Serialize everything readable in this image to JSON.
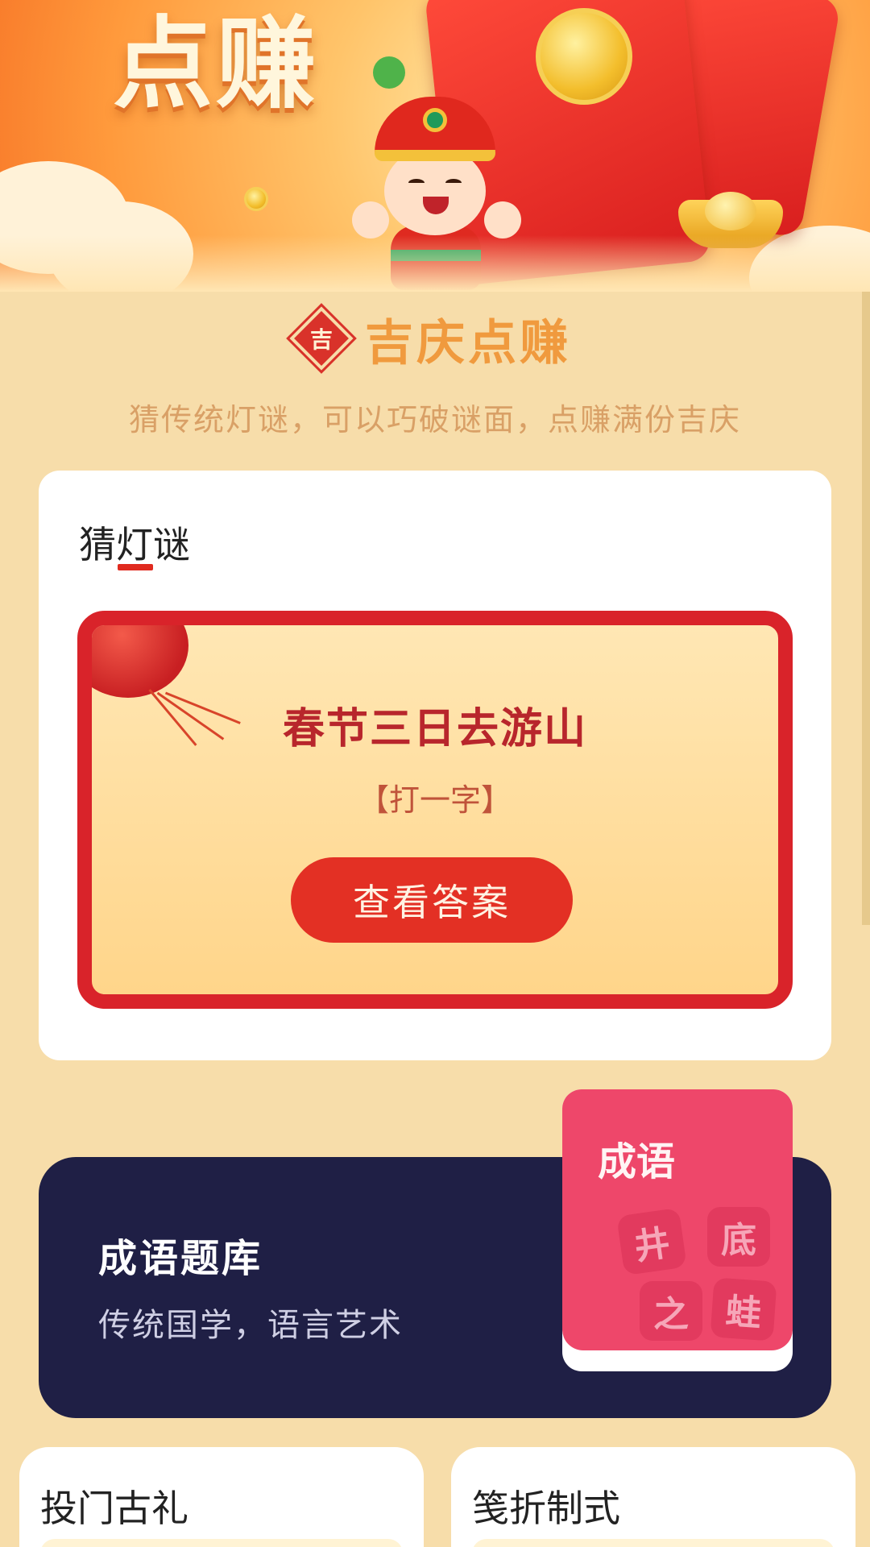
{
  "banner": {
    "title": "点赚"
  },
  "header": {
    "badge_char": "吉",
    "title": "吉庆点赚",
    "subtitle": "猜传统灯谜，可以巧破谜面，点赚满份吉庆"
  },
  "riddle_card": {
    "tab_label": "猜灯谜",
    "question": "春节三日去游山",
    "hint": "【打一字】",
    "answer_button": "查看答案"
  },
  "idiom_bank": {
    "title": "成语题库",
    "description": "传统国学，语言艺术",
    "book_title": "成语",
    "book_chars": [
      "井",
      "底",
      "之",
      "蛙"
    ]
  },
  "bottom_cards": [
    {
      "title": "投门古礼"
    },
    {
      "title": "笺折制式"
    }
  ],
  "colors": {
    "accent_red": "#e33024",
    "heading_orange": "#f09a3e",
    "page_bg": "#f7ddaa",
    "idiom_navy": "#1f1f45",
    "book_pink": "#ee476a"
  }
}
